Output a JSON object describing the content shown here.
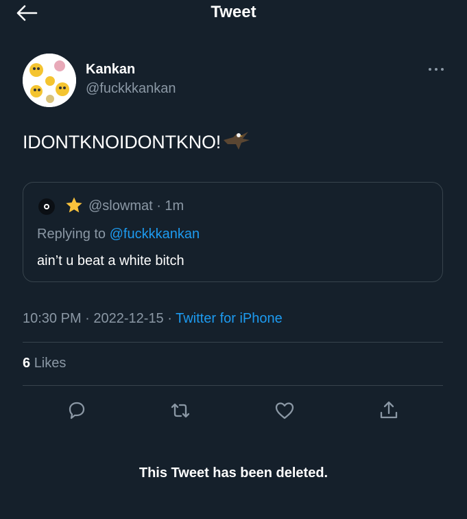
{
  "header": {
    "title": "Tweet",
    "back_icon": "arrow-left-icon"
  },
  "tweet": {
    "author": {
      "display_name": "Kankan",
      "handle": "@fuckkkankan"
    },
    "more_icon": "more-dots-icon",
    "text": "IDONTKNOIDONTKNO!",
    "emoji_icon": "eagle-emoji-icon",
    "quote": {
      "star_icon": "star-emoji-icon",
      "meta": "@slowmat · 1m",
      "replying_prefix": "Replying to",
      "replying_to": "@fuckkkankan",
      "text": "ain’t u beat a white bitch"
    },
    "time": "10:30 PM · 2022-12-15 ·",
    "source": "Twitter for iPhone",
    "likes_count": "6",
    "likes_label": "Likes",
    "actions": {
      "reply_icon": "reply-icon",
      "retweet_icon": "retweet-icon",
      "like_icon": "heart-icon",
      "share_icon": "share-icon"
    }
  },
  "footer": {
    "deleted_notice": "This Tweet has been deleted."
  },
  "colors": {
    "background": "#15202b",
    "accent": "#1d9bf0",
    "secondary_text": "#8b98a5",
    "border": "#38444d"
  }
}
